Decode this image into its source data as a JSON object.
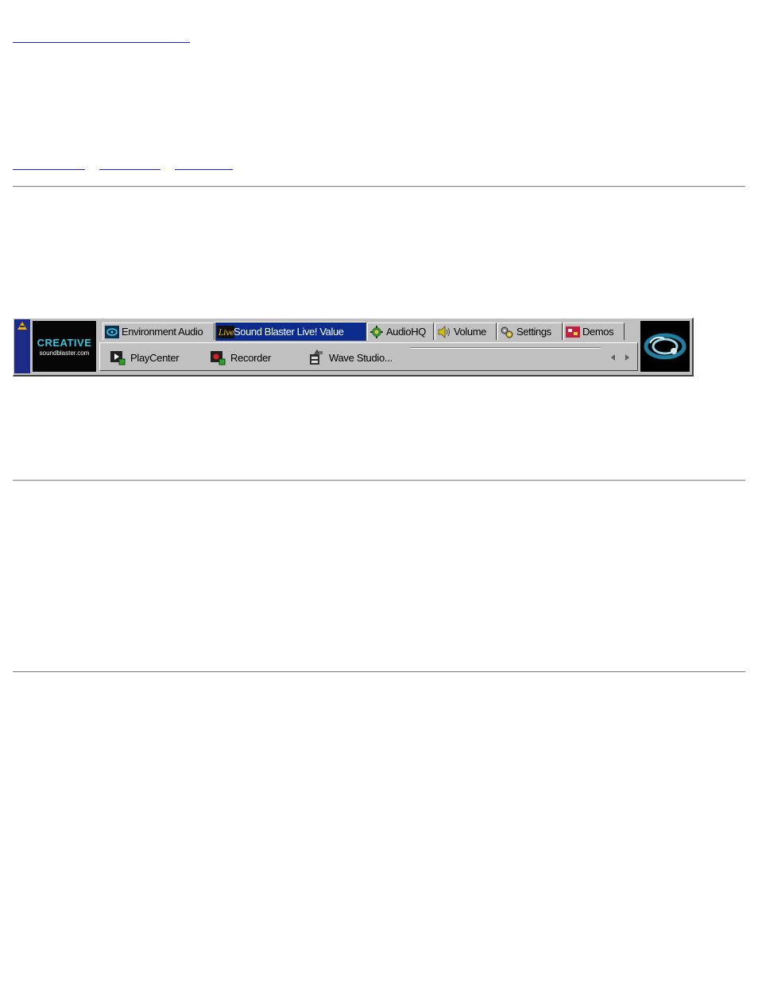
{
  "page": {
    "link_top": "",
    "nav_links": [
      "",
      "",
      ""
    ]
  },
  "launcher": {
    "logo": {
      "brand": "CREATIVE",
      "site": "soundblaster.com"
    },
    "tabs": [
      {
        "label": "Environment Audio",
        "icon": "environment-audio-icon",
        "active": false
      },
      {
        "label": "Sound Blaster Live! Value",
        "icon": "live-logo-icon",
        "active": true
      },
      {
        "label": "AudioHQ",
        "icon": "audiohq-icon",
        "active": false
      },
      {
        "label": "Volume",
        "icon": "speaker-icon",
        "active": false
      },
      {
        "label": "Settings",
        "icon": "gears-icon",
        "active": false
      },
      {
        "label": "Demos",
        "icon": "demos-icon",
        "active": false
      }
    ],
    "items": [
      {
        "label": "PlayCenter",
        "icon": "playcenter-icon"
      },
      {
        "label": "Recorder",
        "icon": "recorder-icon"
      },
      {
        "label": "Wave Studio...",
        "icon": "wave-studio-icon"
      }
    ],
    "colors": {
      "active_tab": "#0b2c8c",
      "grip": "#1b2b86",
      "logo_text": "#35c8e0"
    }
  }
}
